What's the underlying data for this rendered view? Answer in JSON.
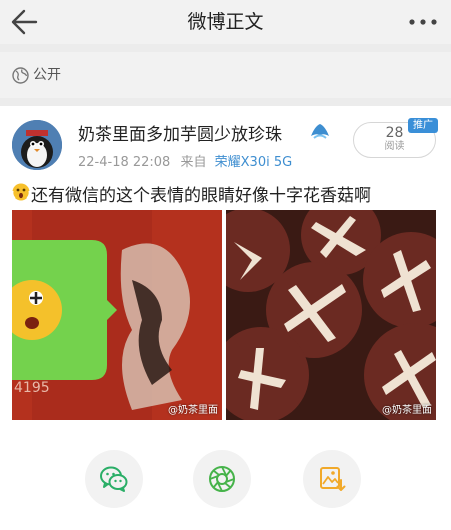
{
  "header": {
    "title": "微博正文",
    "back_icon": "back-arrow-icon",
    "more_icon": "more-dots-icon"
  },
  "visibility": {
    "icon": "globe-icon",
    "label": "公开"
  },
  "post": {
    "author": "奶茶里面多加芋圆少放珍珠",
    "meta_date": "22-4-18 22:08",
    "meta_from": "来自",
    "meta_device": "荣耀X30i 5G",
    "read_count": "28",
    "read_label": "阅读",
    "promo_tag": "推广",
    "text": "还有微信的这个表情的眼睛好像十字花香菇啊",
    "photos": [
      {
        "watermark": "@奶茶里面"
      },
      {
        "watermark": "@奶茶里面"
      }
    ],
    "left_photo_number": "4195"
  },
  "actions": [
    {
      "icon": "wechat-icon",
      "color": "#2aae67"
    },
    {
      "icon": "moments-icon",
      "color": "#46b34a"
    },
    {
      "icon": "save-image-icon",
      "color": "#f1a92a"
    }
  ],
  "colors": {
    "link_blue": "#3e8ed0",
    "background": "#f2f2f2"
  }
}
